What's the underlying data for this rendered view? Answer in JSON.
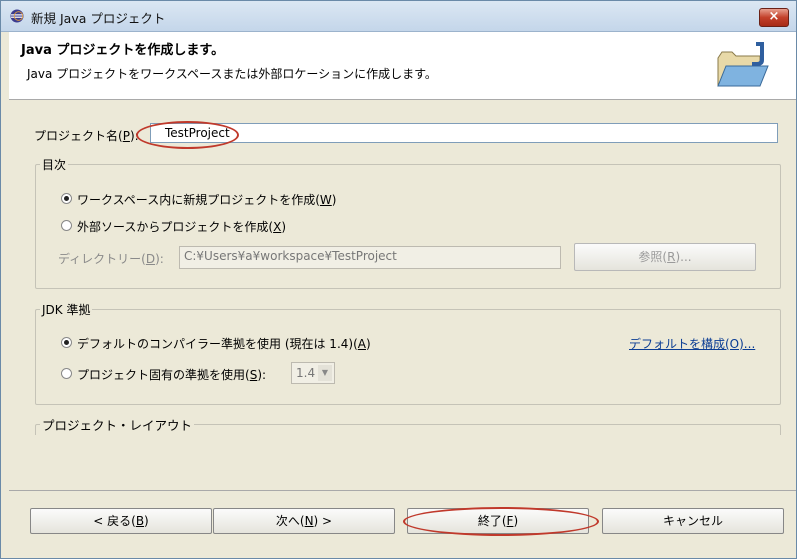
{
  "window": {
    "title": "新規 Java プロジェクト",
    "close_glyph": "×"
  },
  "banner": {
    "title": "Java プロジェクトを作成します。",
    "description": "Java プロジェクトをワークスペースまたは外部ロケーションに作成します。",
    "icon": "java-project-folder-icon"
  },
  "project_name": {
    "label": "プロジェクト名(",
    "mnemonic": "P",
    "label_end": "):",
    "value": "TestProject"
  },
  "contents": {
    "legend": "目次",
    "option_workspace": {
      "text": "ワークスペース内に新規プロジェクトを作成(",
      "mnemonic": "W",
      "end": ")",
      "selected": true
    },
    "option_external": {
      "text": "外部ソースからプロジェクトを作成(",
      "mnemonic": "X",
      "end": ")",
      "selected": false
    },
    "directory_label": {
      "text": "ディレクトリー(",
      "mnemonic": "D",
      "end": "):"
    },
    "directory_value": "C:¥Users¥a¥workspace¥TestProject",
    "browse_button": {
      "text": "参照(",
      "mnemonic": "R",
      "end": ")..."
    }
  },
  "jdk": {
    "legend": "JDK 準拠",
    "option_default": {
      "text": "デフォルトのコンパイラー準拠を使用 (現在は 1.4)(",
      "mnemonic": "A",
      "end": ")",
      "selected": true
    },
    "option_specific": {
      "text": "プロジェクト固有の準拠を使用(",
      "mnemonic": "S",
      "end": "):",
      "selected": false
    },
    "compliance_value": "1.4",
    "configure_link": "デフォルトを構成(O)..."
  },
  "layout": {
    "legend": "プロジェクト・レイアウト"
  },
  "buttons": {
    "back": {
      "text": "< 戻る(",
      "mnemonic": "B",
      "end": ")"
    },
    "next": {
      "text": "次へ(",
      "mnemonic": "N",
      "end": ") >"
    },
    "finish": {
      "text": "終了(",
      "mnemonic": "F",
      "end": ")"
    },
    "cancel": "キャンセル"
  },
  "colors": {
    "highlight_ellipse": "#c0392b",
    "link": "#0b3d94"
  }
}
